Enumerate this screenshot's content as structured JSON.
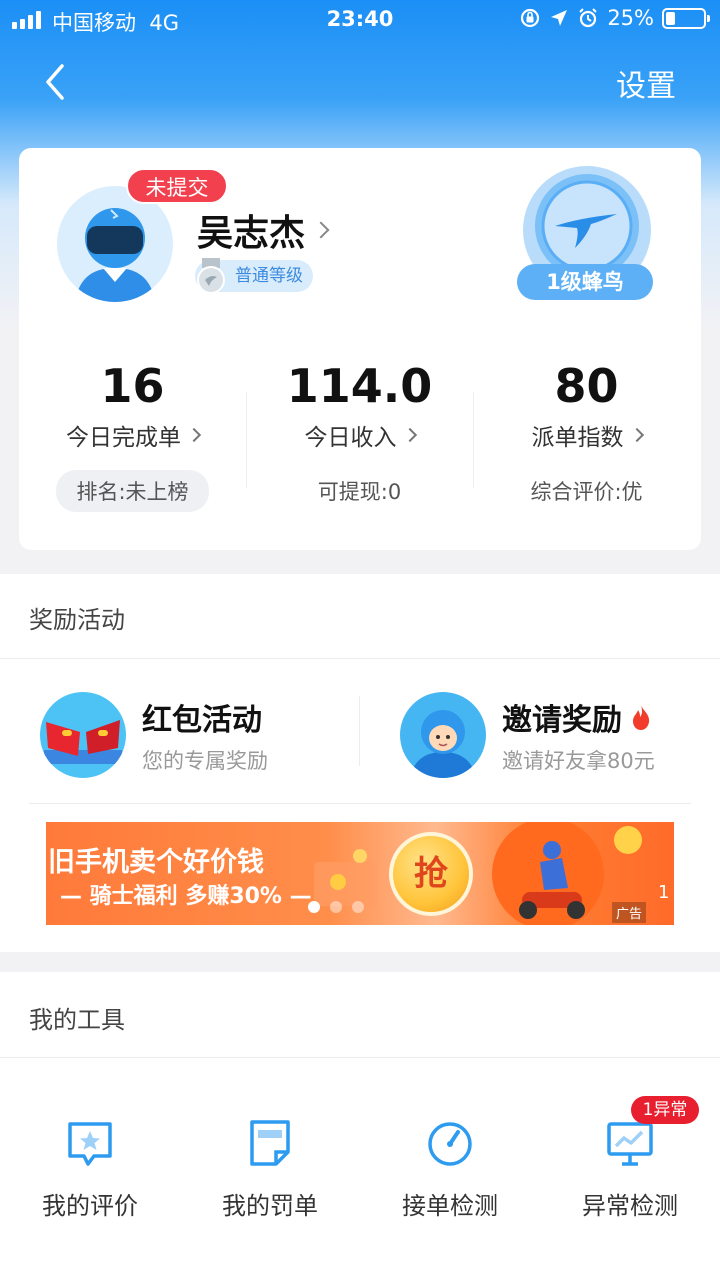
{
  "status_bar": {
    "carrier": "中国移动",
    "network": "4G",
    "time": "23:40",
    "battery": "25%"
  },
  "nav": {
    "settings_label": "设置"
  },
  "profile": {
    "status_badge": "未提交",
    "name": "吴志杰",
    "level": "普通等级",
    "rank_badge": "1级蜂鸟",
    "stats": [
      {
        "value": "16",
        "label": "今日完成单",
        "sub": "排名:未上榜"
      },
      {
        "value": "114.0",
        "label": "今日收入",
        "sub": "可提现:0"
      },
      {
        "value": "80",
        "label": "派单指数",
        "sub": "综合评价:优"
      }
    ]
  },
  "rewards": {
    "title": "奖励活动",
    "items": [
      {
        "title": "红包活动",
        "subtitle": "您的专属奖励",
        "icon": "red-envelope-icon"
      },
      {
        "title": "邀请奖励",
        "subtitle": "邀请好友拿80元",
        "icon": "rider-avatar-icon"
      }
    ],
    "banner": {
      "title": "旧手机卖个好价钱",
      "subtitle": "— 骑士福利  多赚30% —",
      "button": "抢",
      "ad_label": "广告"
    }
  },
  "tools": {
    "title": "我的工具",
    "items": [
      {
        "label": "我的评价",
        "icon": "star-chat-icon"
      },
      {
        "label": "我的罚单",
        "icon": "ticket-icon"
      },
      {
        "label": "接单检测",
        "icon": "gauge-icon"
      },
      {
        "label": "异常检测",
        "icon": "monitor-icon"
      }
    ],
    "alert_badge": "1异常"
  },
  "colors": {
    "primary": "#1b8ff6",
    "alert": "#f2404e",
    "icon_blue": "#2d9bf0"
  }
}
